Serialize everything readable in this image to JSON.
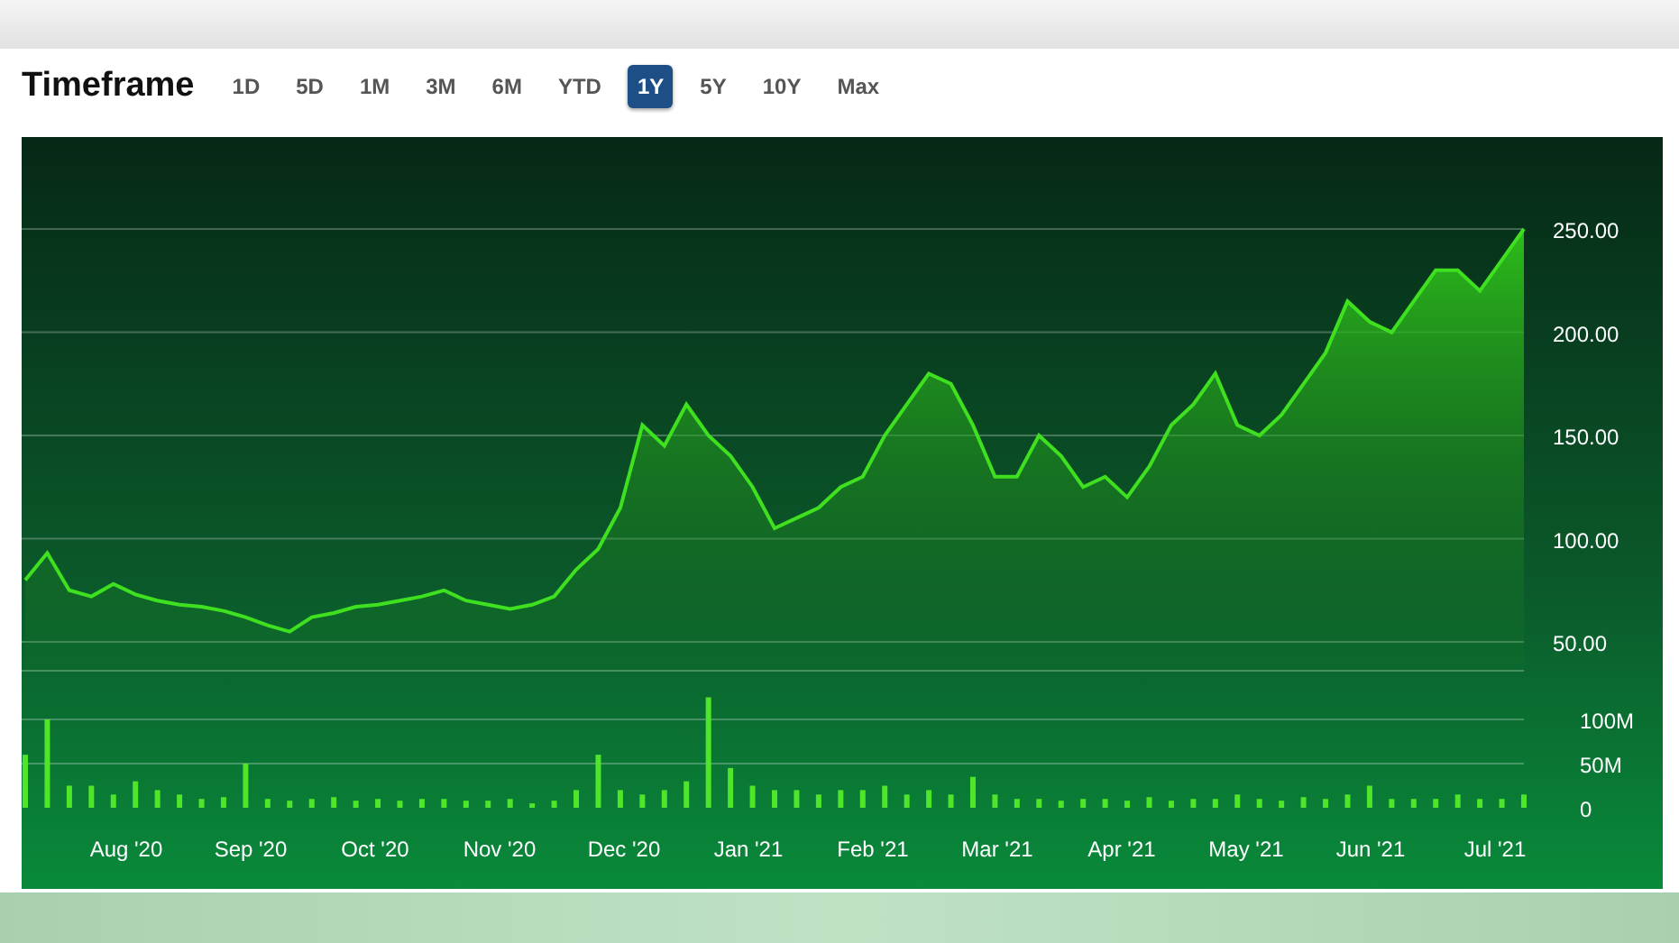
{
  "header": {
    "title": "Timeframe"
  },
  "timeframes": [
    {
      "label": "1D",
      "selected": false
    },
    {
      "label": "5D",
      "selected": false
    },
    {
      "label": "1M",
      "selected": false
    },
    {
      "label": "3M",
      "selected": false
    },
    {
      "label": "6M",
      "selected": false
    },
    {
      "label": "YTD",
      "selected": false
    },
    {
      "label": "1Y",
      "selected": true
    },
    {
      "label": "5Y",
      "selected": false
    },
    {
      "label": "10Y",
      "selected": false
    },
    {
      "label": "Max",
      "selected": false
    }
  ],
  "price_chart": {
    "chart_data": {
      "type": "area",
      "grid": true,
      "ylim": [
        50,
        250
      ],
      "yticks": [
        {
          "value": 50,
          "label": "50.00"
        },
        {
          "value": 100,
          "label": "100.00"
        },
        {
          "value": 150,
          "label": "150.00"
        },
        {
          "value": 200,
          "label": "200.00"
        },
        {
          "value": 250,
          "label": "250.00"
        }
      ],
      "series": [
        {
          "color": "#3ee01f",
          "values": [
            80,
            93,
            75,
            72,
            78,
            73,
            70,
            68,
            67,
            65,
            62,
            58,
            55,
            62,
            64,
            67,
            68,
            70,
            72,
            75,
            70,
            68,
            66,
            68,
            72,
            85,
            95,
            115,
            155,
            145,
            165,
            150,
            140,
            125,
            105,
            110,
            115,
            125,
            130,
            150,
            165,
            180,
            175,
            155,
            130,
            130,
            150,
            140,
            125,
            130,
            120,
            135,
            155,
            165,
            180,
            155,
            150,
            160,
            175,
            190,
            215,
            205,
            200,
            215,
            230,
            230,
            220,
            235,
            250
          ]
        }
      ]
    }
  },
  "volume_chart": {
    "x_labels": [
      "Aug '20",
      "Sep '20",
      "Oct '20",
      "Nov '20",
      "Dec '20",
      "Jan '21",
      "Feb '21",
      "Mar '21",
      "Apr '21",
      "May '21",
      "Jun '21",
      "Jul '21"
    ],
    "chart_data": {
      "type": "bar",
      "grid": true,
      "ylim": [
        0,
        130
      ],
      "yticks": [
        {
          "value": 0,
          "label": "0"
        },
        {
          "value": 50,
          "label": "50M"
        },
        {
          "value": 100,
          "label": "100M"
        }
      ],
      "series": [
        {
          "color": "#4fe52a",
          "values": [
            60,
            100,
            25,
            25,
            15,
            30,
            20,
            15,
            10,
            12,
            50,
            10,
            8,
            10,
            12,
            8,
            10,
            8,
            10,
            10,
            8,
            8,
            10,
            5,
            8,
            20,
            60,
            20,
            15,
            20,
            30,
            125,
            45,
            25,
            20,
            20,
            15,
            20,
            20,
            25,
            15,
            20,
            15,
            35,
            15,
            10,
            10,
            8,
            10,
            10,
            8,
            12,
            8,
            10,
            10,
            15,
            10,
            8,
            12,
            10,
            15,
            25,
            10,
            10,
            10,
            15,
            10,
            10,
            15
          ]
        }
      ]
    }
  }
}
